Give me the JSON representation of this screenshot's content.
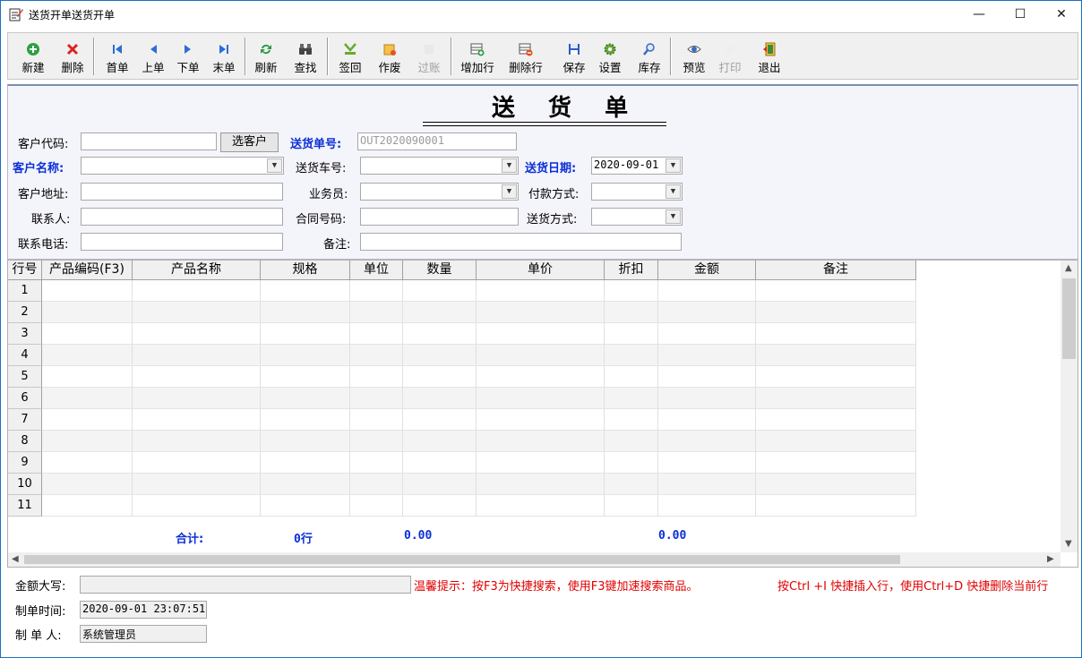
{
  "window": {
    "title": "送货开单送货开单",
    "controls": {
      "minimize": "—",
      "maximize": "☐",
      "close": "✕"
    }
  },
  "toolbar": {
    "buttons": [
      {
        "label": "新建",
        "icon": "add-icon",
        "color": "#2ea043",
        "enabled": true
      },
      {
        "label": "删除",
        "icon": "delete-icon",
        "color": "#e02020",
        "enabled": true
      },
      {
        "label": "首单",
        "icon": "first-icon",
        "color": "#2a6dd6",
        "enabled": true
      },
      {
        "label": "上单",
        "icon": "prev-icon",
        "color": "#2a6dd6",
        "enabled": true
      },
      {
        "label": "下单",
        "icon": "next-icon",
        "color": "#2a6dd6",
        "enabled": true
      },
      {
        "label": "末单",
        "icon": "last-icon",
        "color": "#2a6dd6",
        "enabled": true
      },
      {
        "label": "刷新",
        "icon": "refresh-icon",
        "color": "#2e9a44",
        "enabled": true
      },
      {
        "label": "查找",
        "icon": "binoculars-icon",
        "color": "#555555",
        "enabled": true
      },
      {
        "label": "签回",
        "icon": "signback-icon",
        "color": "#6aa833",
        "enabled": true
      },
      {
        "label": "作废",
        "icon": "void-icon",
        "color": "#e8a020",
        "enabled": true
      },
      {
        "label": "过账",
        "icon": "post-icon",
        "color": "#bbbbbb",
        "enabled": false
      },
      {
        "label": "增加行",
        "icon": "add-row-icon",
        "color": "#3a8a3a",
        "enabled": true
      },
      {
        "label": "删除行",
        "icon": "delete-row-icon",
        "color": "#c04020",
        "enabled": true
      },
      {
        "label": "保存",
        "icon": "save-icon",
        "color": "#2a5cc4",
        "enabled": true
      },
      {
        "label": "设置",
        "icon": "gear-icon",
        "color": "#5a9a3a",
        "enabled": true
      },
      {
        "label": "库存",
        "icon": "inventory-icon",
        "color": "#3a6ac4",
        "enabled": true
      },
      {
        "label": "预览",
        "icon": "eye-icon",
        "color": "#3a6ac4",
        "enabled": true
      },
      {
        "label": "打印",
        "icon": "print-icon",
        "color": "#bbbbbb",
        "enabled": false
      },
      {
        "label": "退出",
        "icon": "exit-icon",
        "color": "#3a8a3a",
        "enabled": true
      }
    ]
  },
  "form": {
    "doc_title": "送 货 单",
    "customer_code": {
      "label": "客户代码:",
      "value": "",
      "button": "选客户"
    },
    "delivery_no": {
      "label": "送货单号:",
      "value": "OUT2020090001"
    },
    "customer_name": {
      "label": "客户名称:",
      "value": ""
    },
    "vehicle_no": {
      "label": "送货车号:",
      "value": ""
    },
    "delivery_date": {
      "label": "送货日期:",
      "value": "2020-09-01"
    },
    "customer_address": {
      "label": "客户地址:",
      "value": ""
    },
    "salesperson": {
      "label": "业务员:",
      "value": ""
    },
    "payment_method": {
      "label": "付款方式:",
      "value": ""
    },
    "contact": {
      "label": "联系人:",
      "value": ""
    },
    "contract_no": {
      "label": "合同号码:",
      "value": ""
    },
    "delivery_method": {
      "label": "送货方式:",
      "value": ""
    },
    "phone": {
      "label": "联系电话:",
      "value": ""
    },
    "remark": {
      "label": "备注:",
      "value": ""
    }
  },
  "grid": {
    "columns": [
      "行号",
      "产品编码(F3)",
      "产品名称",
      "规格",
      "单位",
      "数量",
      "单价",
      "折扣",
      "金额",
      "备注"
    ],
    "row_numbers": [
      "1",
      "2",
      "3",
      "4",
      "5",
      "6",
      "7",
      "8",
      "9",
      "10",
      "11"
    ],
    "totals": {
      "label": "合计:",
      "rows": "0行",
      "quantity": "0.00",
      "amount": "0.00"
    }
  },
  "footer": {
    "amount_words": {
      "label": "金额大写:",
      "value": ""
    },
    "created_time": {
      "label": "制单时间:",
      "value": "2020-09-01 23:07:51"
    },
    "creator": {
      "label": "制 单 人:",
      "value": "系统管理员"
    },
    "hint1": "温馨提示：按F3为快捷搜索，使用F3键加速搜索商品。",
    "hint2": "按Ctrl +I 快捷插入行，使用Ctrl+D 快捷删除当前行"
  }
}
